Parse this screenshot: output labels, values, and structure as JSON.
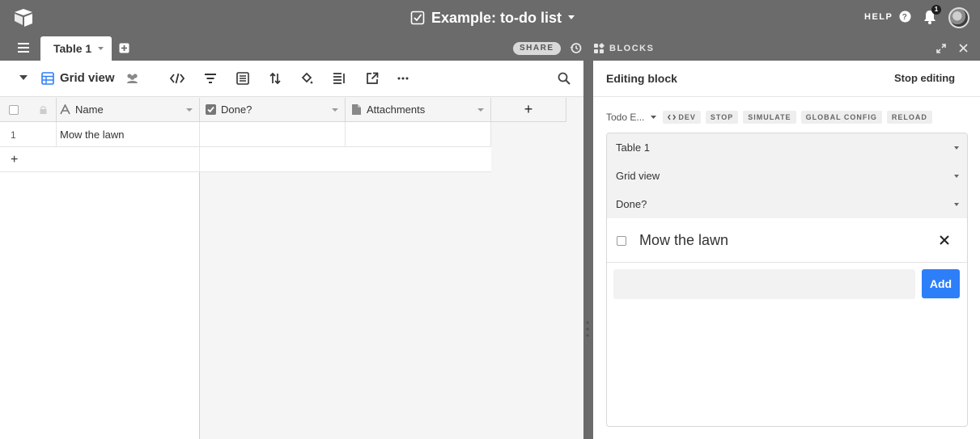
{
  "app": {
    "base_title": "Example: to-do list",
    "help_label": "HELP",
    "notification_count": "1"
  },
  "tabs": {
    "active_table": "Table 1",
    "share_label": "SHARE",
    "blocks_label": "BLOCKS"
  },
  "view": {
    "name": "Grid view",
    "toolbar_icons": [
      "code-icon",
      "filter-icon",
      "group-icon",
      "sort-icon",
      "color-icon",
      "row-height-icon",
      "share-view-icon",
      "more-icon"
    ]
  },
  "table": {
    "columns": [
      {
        "label": "Name",
        "icon": "text-field-icon"
      },
      {
        "label": "Done?",
        "icon": "checkbox-field-icon"
      },
      {
        "label": "Attachments",
        "icon": "attachment-field-icon"
      }
    ],
    "add_column_label": "+",
    "rows": [
      {
        "number": "1",
        "name": "Mow the lawn",
        "done": "",
        "attachments": ""
      }
    ],
    "add_row_label": "+"
  },
  "panel": {
    "title": "Editing block",
    "stop_editing_label": "Stop editing",
    "block_name": "Todo E...",
    "dev_buttons": [
      "DEV",
      "STOP",
      "SIMULATE",
      "GLOBAL CONFIG",
      "RELOAD"
    ],
    "pickers": {
      "table": "Table 1",
      "view": "Grid view",
      "field": "Done?"
    },
    "todo_items": [
      {
        "label": "Mow the lawn",
        "done": false
      }
    ],
    "new_todo_value": "",
    "add_label": "Add"
  },
  "colors": {
    "chrome": "#6b6b6b",
    "accent": "#2d7ff9",
    "grid_icon": "#2d7ff9"
  }
}
